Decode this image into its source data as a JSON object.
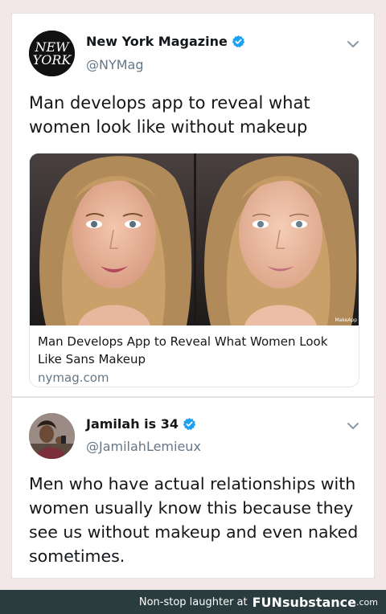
{
  "tweets": [
    {
      "display_name": "New York Magazine",
      "handle": "@NYMag",
      "avatar_text": [
        "NEW",
        "YORK"
      ],
      "verified_icon": "verified-badge-icon",
      "text": "Man develops app to reveal what women look like without makeup",
      "link_card": {
        "image_watermark": "MakeApp",
        "title": "Man Develops App to Reveal What Women Look Like Sans Makeup",
        "domain": "nymag.com"
      }
    },
    {
      "display_name": "Jamilah is 34",
      "handle": "@JamilahLemieux",
      "verified_icon": "verified-badge-icon",
      "text": "Men who have actual relationships with women usually know this because they see us without makeup and even naked sometimes."
    }
  ],
  "footer": {
    "caption": "Non-stop laughter at",
    "brand_fun": "FUN",
    "brand_sub": "substance",
    "brand_tld": ".com"
  },
  "colors": {
    "page_background": "#f3e7e7",
    "verified_blue": "#1da1f2",
    "handle_gray": "#657786",
    "footer_background": "#2a3c3d"
  }
}
